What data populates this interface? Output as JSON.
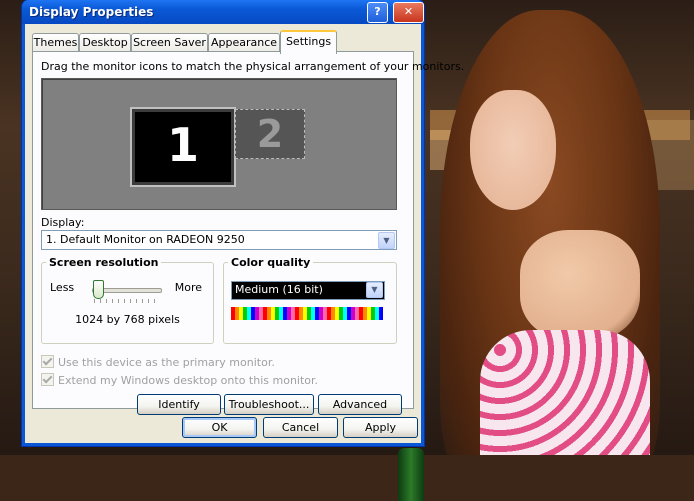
{
  "window": {
    "title": "Display Properties",
    "help_glyph": "?",
    "close_glyph": "✕"
  },
  "tabs": [
    {
      "label": "Themes"
    },
    {
      "label": "Desktop"
    },
    {
      "label": "Screen Saver"
    },
    {
      "label": "Appearance"
    },
    {
      "label": "Settings",
      "active": true
    }
  ],
  "settings": {
    "instruction": "Drag the monitor icons to match the physical arrangement of your monitors.",
    "monitors": [
      {
        "number": "1",
        "primary": true
      },
      {
        "number": "2",
        "primary": false
      }
    ],
    "display_label": "Display:",
    "display_value": "1. Default Monitor on RADEON 9250",
    "resolution": {
      "legend": "Screen resolution",
      "less": "Less",
      "more": "More",
      "value_text": "1024 by 768 pixels",
      "slider_level": 0
    },
    "color_quality": {
      "legend": "Color quality",
      "value": "Medium (16 bit)"
    },
    "checkboxes": [
      {
        "label": "Use this device as the primary monitor.",
        "checked": true,
        "enabled": false
      },
      {
        "label": "Extend my Windows desktop onto this monitor.",
        "checked": true,
        "enabled": false
      }
    ],
    "buttons": {
      "identify": "Identify",
      "troubleshoot": "Troubleshoot...",
      "advanced": "Advanced"
    }
  },
  "dialog_buttons": {
    "ok": "OK",
    "cancel": "Cancel",
    "apply": "Apply"
  },
  "colors": {
    "title_bar": "#0a58d6",
    "dialog_bg": "#ece9d8",
    "active_tab_accent": "#ffc83c"
  },
  "icons": {
    "dropdown": "chevron-down-icon",
    "help": "help-icon",
    "close": "close-icon"
  }
}
